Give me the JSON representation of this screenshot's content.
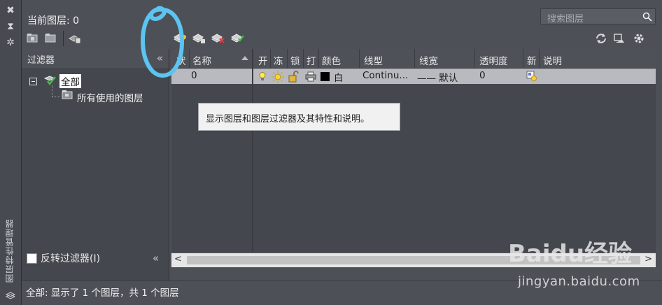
{
  "window": {
    "vertical_title": "图层特性管理器",
    "current_layer": "当前图层: 0",
    "search_placeholder": "搜索图层",
    "status": "全部: 显示了 1 个图层，共 1 个图层"
  },
  "filter_panel": {
    "title": "过滤器",
    "tree": [
      {
        "label": "全部",
        "selected": true
      },
      {
        "label": "所有使用的图层",
        "selected": false
      }
    ],
    "invert_label": "反转过滤器(I)",
    "invert_checked": false
  },
  "grid": {
    "columns": [
      "状",
      "名称",
      "开",
      "冻",
      "锁",
      "打",
      "颜色",
      "线型",
      "线宽",
      "透明度",
      "新",
      "说明"
    ],
    "rows": [
      {
        "status": "",
        "name": "0",
        "on": "lightbulb-icon",
        "freeze": "sun-icon",
        "lock": "unlocked-icon",
        "plot": "printer-icon",
        "color_name": "白",
        "color_swatch": "#000000",
        "linetype": "Continu...",
        "lineweight": "—— 默认",
        "transparency": "0",
        "new_vp": "new-vp-freeze-icon",
        "description": ""
      }
    ]
  },
  "tooltip": {
    "text": "显示图层和图层过滤器及其特性和说明。"
  },
  "watermark": {
    "url": "jingyan.baidu.com",
    "brand": "Baidu经验"
  },
  "colors": {
    "annotation_circle": "#5bc4f1",
    "selection_row": "#b8bac0"
  }
}
